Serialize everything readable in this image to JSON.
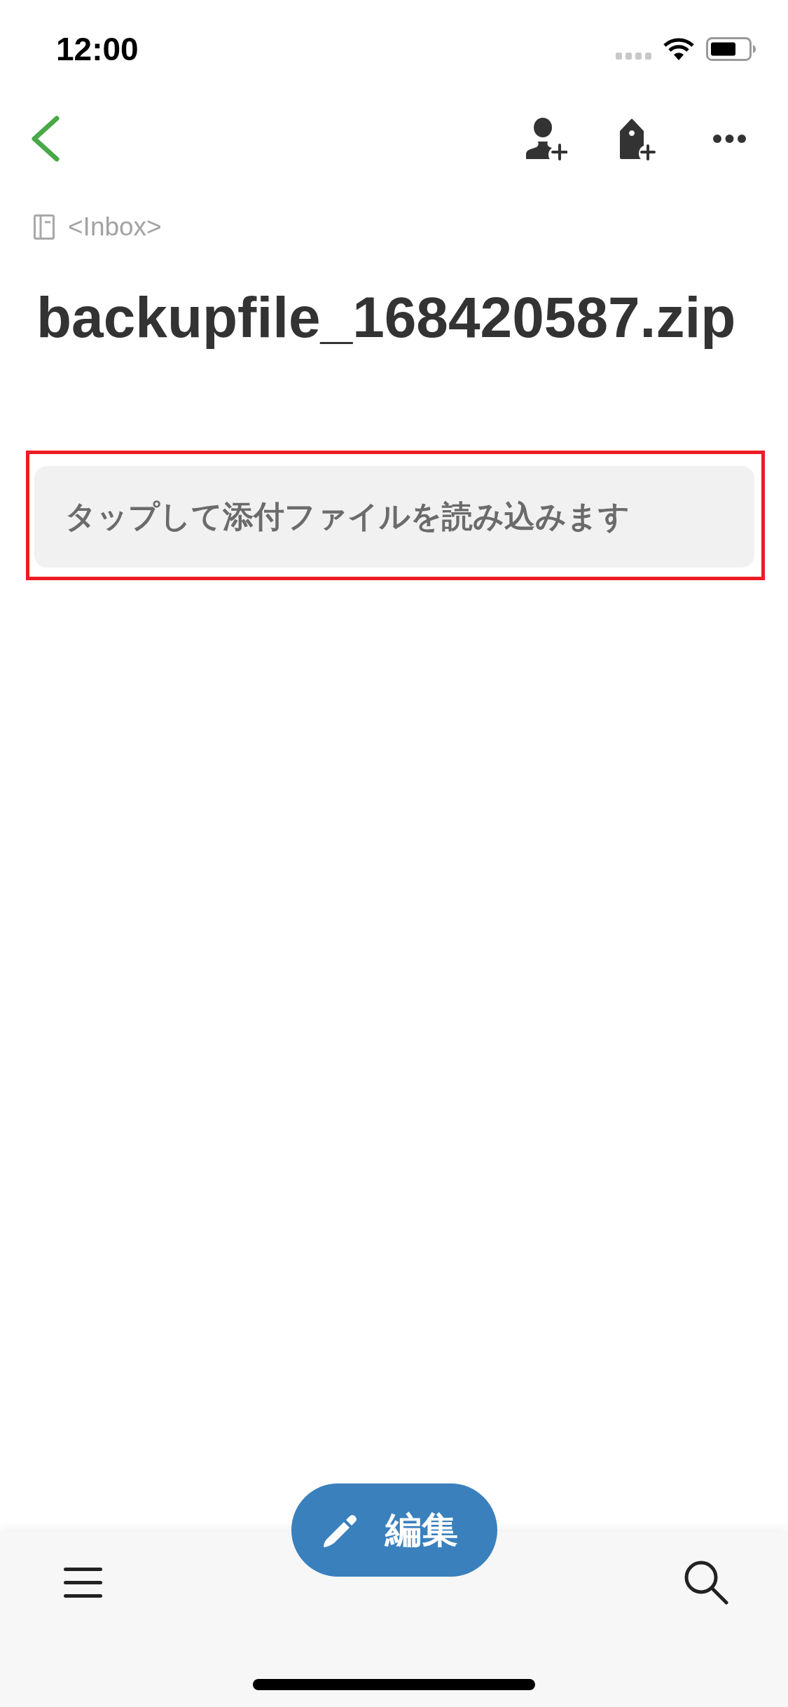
{
  "status_bar": {
    "time": "12:00"
  },
  "notebook": {
    "name": "<Inbox>"
  },
  "note": {
    "title": "backupfile_168420587.zip"
  },
  "attachment": {
    "label": "タップして添付ファイルを読み込みます",
    "highlighted": true
  },
  "edit_button": {
    "label": "編集"
  }
}
